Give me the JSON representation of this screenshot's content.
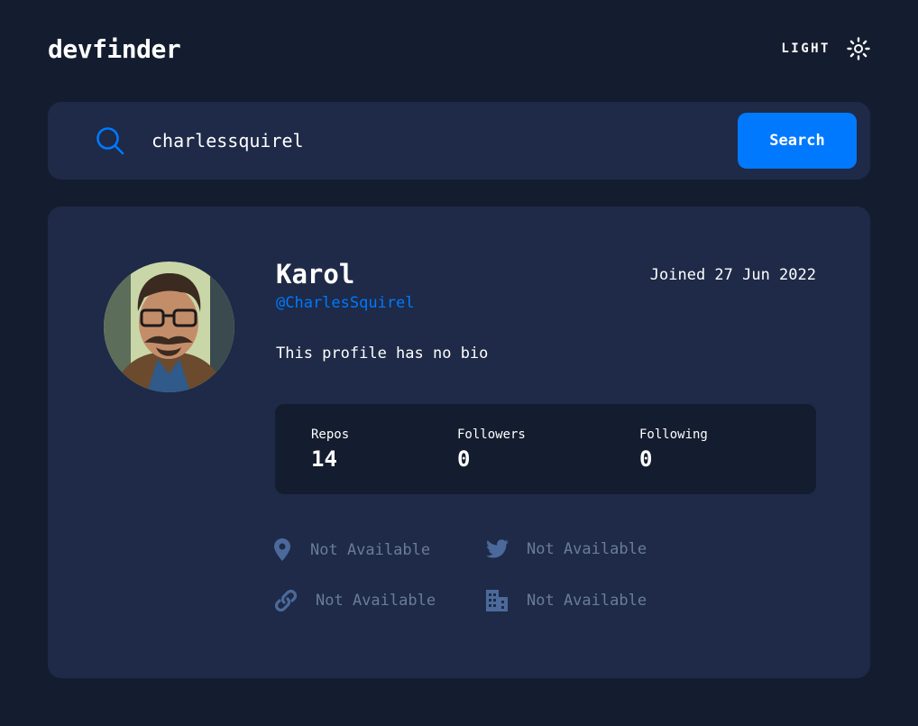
{
  "header": {
    "logo": "devfinder",
    "theme_label": "LIGHT",
    "theme_icon": "sun-icon"
  },
  "search": {
    "value": "charlessquirel",
    "button_label": "Search",
    "icon": "search-icon"
  },
  "profile": {
    "name": "Karol",
    "joined": "Joined 27 Jun 2022",
    "handle": "@CharlesSquirel",
    "bio": "This profile has no bio",
    "avatar": "avatar"
  },
  "stats": [
    {
      "label": "Repos",
      "value": "14"
    },
    {
      "label": "Followers",
      "value": "0"
    },
    {
      "label": "Following",
      "value": "0"
    }
  ],
  "links": {
    "location": {
      "icon": "location-icon",
      "text": "Not Available"
    },
    "twitter": {
      "icon": "twitter-icon",
      "text": "Not Available"
    },
    "website": {
      "icon": "link-icon",
      "text": "Not Available"
    },
    "company": {
      "icon": "company-icon",
      "text": "Not Available"
    }
  },
  "colors": {
    "background": "#141d2f",
    "card": "#1e2a47",
    "accent": "#0079ff",
    "muted": "#697c9a"
  }
}
